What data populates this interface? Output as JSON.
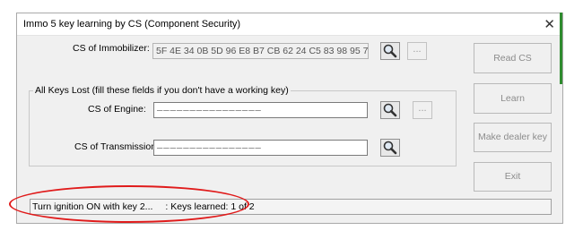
{
  "window": {
    "title": "Immo 5 key learning by CS (Component Security)"
  },
  "immobilizer": {
    "label": "CS of Immobilizer:",
    "value": "5F 4E 34 0B 5D 96 E8 B7 CB 62 24 C5 83 98 95 7F"
  },
  "group": {
    "label": "All Keys Lost (fill these fields if you don't have a working key)"
  },
  "engine": {
    "label": "CS of Engine:",
    "value": "________________"
  },
  "transmission": {
    "label": "CS of Transmission:",
    "value": "________________"
  },
  "dots_label": "...",
  "buttons": {
    "read_cs": "Read CS",
    "learn": "Learn",
    "make_dealer_key": "Make dealer key",
    "exit": "Exit"
  },
  "status": {
    "message": "Turn ignition ON with key 2...",
    "keys_learned": ": Keys learned: 1 of 2"
  },
  "icons": {
    "search": "magnifier-icon",
    "close": "close-icon"
  },
  "colors": {
    "highlight": "#e01b1b",
    "accent_strip": "#2e8b2e"
  }
}
